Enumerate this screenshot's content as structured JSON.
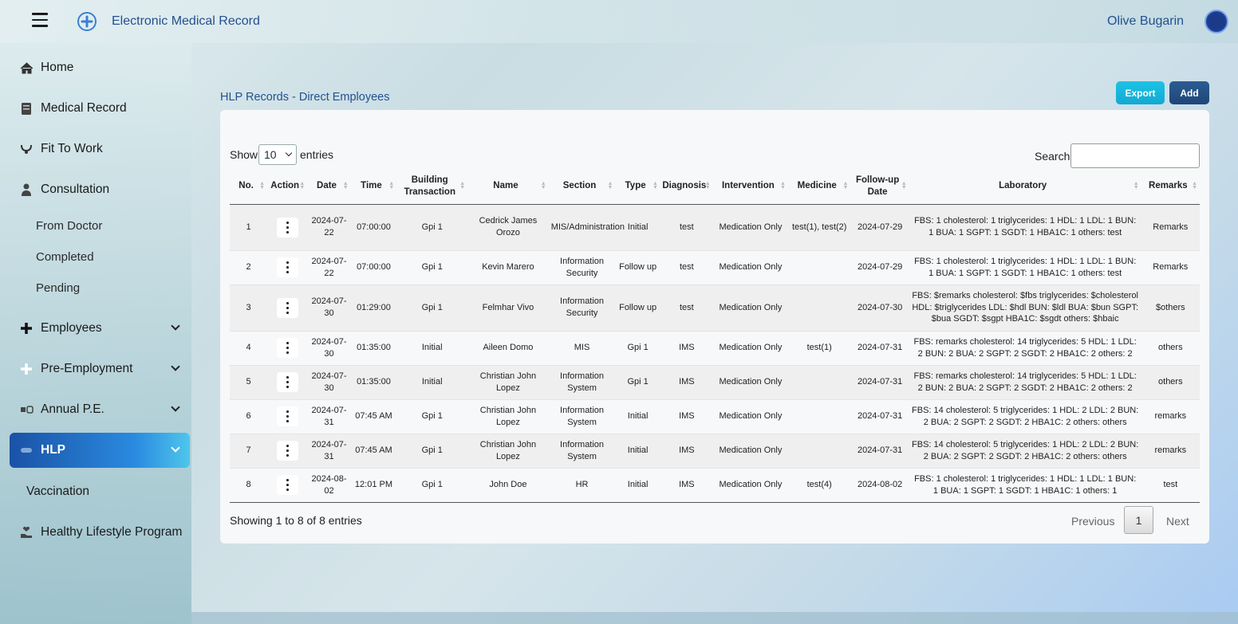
{
  "header": {
    "app_title": "Electronic Medical Record",
    "user_name": "Olive Bugarin"
  },
  "sidebar": {
    "items": [
      {
        "label": "Home",
        "icon": "home-icon"
      },
      {
        "label": "Medical Record",
        "icon": "folder-icon"
      },
      {
        "label": "Fit To Work",
        "icon": "stethoscope-icon"
      },
      {
        "label": "Consultation",
        "icon": "doctor-icon"
      },
      {
        "label": "Employees",
        "icon": "plus-icon"
      },
      {
        "label": "Pre-Employment",
        "icon": "plus-icon"
      },
      {
        "label": "Annual P.E.",
        "icon": "tools-icon"
      },
      {
        "label": "HLP",
        "icon": "pill-icon"
      },
      {
        "label": "Vaccination",
        "icon": ""
      },
      {
        "label": "Healthy Lifestyle Program",
        "icon": "heart-hand-icon"
      }
    ],
    "consultation_sub": [
      "From Doctor",
      "Completed",
      "Pending"
    ]
  },
  "main": {
    "title": "HLP Records - Direct Employees",
    "export_label": "Export",
    "add_label": "Add",
    "show_label": "Show",
    "show_value": "10",
    "entries_label": "entries",
    "search_label": "Search:",
    "info": "Showing 1 to 8 of 8 entries",
    "pagination": {
      "previous": "Previous",
      "page": "1",
      "next": "Next"
    }
  },
  "table": {
    "columns": [
      "No.",
      "Action",
      "Date",
      "Time",
      "Building Transaction",
      "Name",
      "Section",
      "Type",
      "Diagnosis",
      "Intervention",
      "Medicine",
      "Follow-up Date",
      "Laboratory",
      "Remarks"
    ],
    "rows": [
      {
        "no": "1",
        "date": "2024-07-22",
        "time": "07:00:00",
        "building": "Gpi 1",
        "name": "Cedrick James Orozo",
        "section": "MIS/Administration",
        "type": "Initial",
        "diagnosis": "test",
        "intervention": "Medication Only",
        "medicine": "test(1), test(2)",
        "followup": "2024-07-29",
        "laboratory": "FBS: 1 cholesterol: 1 triglycerides: 1 HDL: 1 LDL: 1 BUN: 1 BUA: 1 SGPT: 1 SGDT: 1 HBA1C: 1 others: test",
        "remarks": "Remarks"
      },
      {
        "no": "2",
        "date": "2024-07-22",
        "time": "07:00:00",
        "building": "Gpi 1",
        "name": "Kevin Marero",
        "section": "Information Security",
        "type": "Follow up",
        "diagnosis": "test",
        "intervention": "Medication Only",
        "medicine": "",
        "followup": "2024-07-29",
        "laboratory": "FBS: 1 cholesterol: 1 triglycerides: 1 HDL: 1 LDL: 1 BUN: 1 BUA: 1 SGPT: 1 SGDT: 1 HBA1C: 1 others: test",
        "remarks": "Remarks"
      },
      {
        "no": "3",
        "date": "2024-07-30",
        "time": "01:29:00",
        "building": "Gpi 1",
        "name": "Felmhar Vivo",
        "section": "Information Security",
        "type": "Follow up",
        "diagnosis": "test",
        "intervention": "Medication Only",
        "medicine": "",
        "followup": "2024-07-30",
        "laboratory": "FBS: $remarks cholesterol: $fbs triglycerides: $cholesterol HDL: $triglycerides LDL: $hdl BUN: $ldl BUA: $bun SGPT: $bua SGDT: $sgpt HBA1C: $sgdt others: $hbaic",
        "remarks": "$others"
      },
      {
        "no": "4",
        "date": "2024-07-30",
        "time": "01:35:00",
        "building": "Initial",
        "name": "Aileen Domo",
        "section": "MIS",
        "type": "Gpi 1",
        "diagnosis": "IMS",
        "intervention": "Medication Only",
        "medicine": "test(1)",
        "followup": "2024-07-31",
        "laboratory": "FBS: remarks cholesterol: 14 triglycerides: 5 HDL: 1 LDL: 2 BUN: 2 BUA: 2 SGPT: 2 SGDT: 2 HBA1C: 2 others: 2",
        "remarks": "others"
      },
      {
        "no": "5",
        "date": "2024-07-30",
        "time": "01:35:00",
        "building": "Initial",
        "name": "Christian John Lopez",
        "section": "Information System",
        "type": "Gpi 1",
        "diagnosis": "IMS",
        "intervention": "Medication Only",
        "medicine": "",
        "followup": "2024-07-31",
        "laboratory": "FBS: remarks cholesterol: 14 triglycerides: 5 HDL: 1 LDL: 2 BUN: 2 BUA: 2 SGPT: 2 SGDT: 2 HBA1C: 2 others: 2",
        "remarks": "others"
      },
      {
        "no": "6",
        "date": "2024-07-31",
        "time": "07:45 AM",
        "building": "Gpi 1",
        "name": "Christian John Lopez",
        "section": "Information System",
        "type": "Initial",
        "diagnosis": "IMS",
        "intervention": "Medication Only",
        "medicine": "",
        "followup": "2024-07-31",
        "laboratory": "FBS: 14 cholesterol: 5 triglycerides: 1 HDL: 2 LDL: 2 BUN: 2 BUA: 2 SGPT: 2 SGDT: 2 HBA1C: 2 others: others",
        "remarks": "remarks"
      },
      {
        "no": "7",
        "date": "2024-07-31",
        "time": "07:45 AM",
        "building": "Gpi 1",
        "name": "Christian John Lopez",
        "section": "Information System",
        "type": "Initial",
        "diagnosis": "IMS",
        "intervention": "Medication Only",
        "medicine": "",
        "followup": "2024-07-31",
        "laboratory": "FBS: 14 cholesterol: 5 triglycerides: 1 HDL: 2 LDL: 2 BUN: 2 BUA: 2 SGPT: 2 SGDT: 2 HBA1C: 2 others: others",
        "remarks": "remarks"
      },
      {
        "no": "8",
        "date": "2024-08-02",
        "time": "12:01 PM",
        "building": "Gpi 1",
        "name": "John Doe",
        "section": "HR",
        "type": "Initial",
        "diagnosis": "IMS",
        "intervention": "Medication Only",
        "medicine": "test(4)",
        "followup": "2024-08-02",
        "laboratory": "FBS: 1 cholesterol: 1 triglycerides: 1 HDL: 1 LDL: 1 BUN: 1 BUA: 1 SGPT: 1 SGDT: 1 HBA1C: 1 others: 1",
        "remarks": "test"
      }
    ]
  },
  "colors": {
    "accent_blue": "#23508f",
    "export_button": "#12a9d3",
    "add_button": "#1f4677",
    "active_nav_start": "#1a52a6",
    "active_nav_end": "#4fc6ec"
  }
}
